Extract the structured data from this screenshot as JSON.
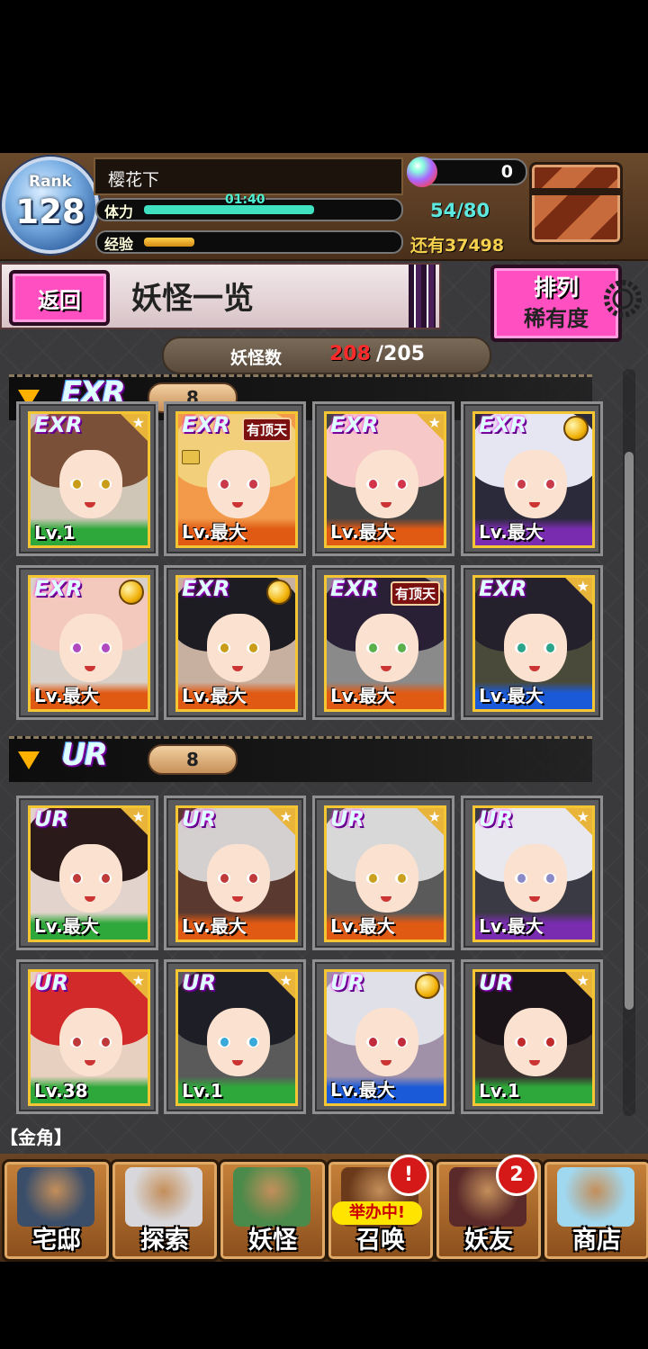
{
  "colors": {
    "accent_pink": "#ff4fc1",
    "gold": "#f6d14d",
    "stamina": "#5de8e0",
    "count_red": "#ff2a2a"
  },
  "header": {
    "rank_label": "Rank",
    "rank_value": "128",
    "player_name": "樱花下",
    "stamina_label": "体力",
    "stamina_timer": "01:40",
    "stamina_value": "54/80",
    "stamina_fraction": 0.675,
    "exp_label": "经验",
    "exp_fraction": 0.2,
    "gem_count": "0",
    "gold_text": "还有37498"
  },
  "title_bar": {
    "back_label": "返回",
    "page_title": "妖怪一览",
    "sort_label": "排列",
    "sort_value": "稀有度"
  },
  "monster_count": {
    "label": "妖怪数",
    "owned": "208",
    "capacity": "/205"
  },
  "sections": [
    {
      "rarity": "EXR",
      "count": "8",
      "cards": [
        {
          "rarity": "EXR",
          "level": "Lv.1",
          "strip": "#2ea83a",
          "hair": "#7a5138",
          "eye": "#c99c1a",
          "bg": "#cfc6b8",
          "mark": "star",
          "lock": false
        },
        {
          "rarity": "EXR",
          "level": "Lv.最大",
          "strip": "#e05a14",
          "hair": "#f2cf7a",
          "eye": "#c93a4a",
          "bg": "#f29a4a",
          "mark": "tag",
          "tag": "有顶天",
          "lock": true
        },
        {
          "rarity": "EXR",
          "level": "Lv.最大",
          "strip": "#e05a14",
          "hair": "#f7c8c8",
          "eye": "#d2344a",
          "bg": "#444",
          "mark": "star",
          "lock": false
        },
        {
          "rarity": "EXR",
          "level": "Lv.最大",
          "strip": "#7a2cb0",
          "hair": "#e6e6f2",
          "eye": "#c93a4a",
          "bg": "#2a2a3a",
          "mark": "medal",
          "lock": false
        },
        {
          "rarity": "EXR",
          "level": "Lv.最大",
          "strip": "#e05a14",
          "hair": "#f3c9bd",
          "eye": "#b048c0",
          "bg": "#d8d0c8",
          "mark": "medal",
          "lock": false
        },
        {
          "rarity": "EXR",
          "level": "Lv.最大",
          "strip": "#e05a14",
          "hair": "#1c1c22",
          "eye": "#c99c1a",
          "bg": "#c8b0a0",
          "mark": "medal",
          "lock": false
        },
        {
          "rarity": "EXR",
          "level": "Lv.最大",
          "strip": "#e05a14",
          "hair": "#2a2036",
          "eye": "#5ab04a",
          "bg": "#8a8a8a",
          "mark": "tag",
          "tag": "有顶天",
          "lock": false
        },
        {
          "rarity": "EXR",
          "level": "Lv.最大",
          "strip": "#1a5ad8",
          "hair": "#24202c",
          "eye": "#2aa58a",
          "bg": "#4a4a3a",
          "mark": "star",
          "lock": false
        }
      ]
    },
    {
      "rarity": "UR",
      "count": "8",
      "cards": [
        {
          "rarity": "UR",
          "level": "Lv.最大",
          "strip": "#2ea83a",
          "hair": "#2a1a1a",
          "eye": "#c03a3a",
          "bg": "#e2d4cc",
          "mark": "star",
          "lock": false
        },
        {
          "rarity": "UR",
          "level": "Lv.最大",
          "strip": "#e05a14",
          "hair": "#d4d0d0",
          "eye": "#c03a3a",
          "bg": "#5a3a30",
          "mark": "star",
          "lock": false
        },
        {
          "rarity": "UR",
          "level": "Lv.最大",
          "strip": "#e05a14",
          "hair": "#d8d8d8",
          "eye": "#c9a020",
          "bg": "#5a5a5a",
          "mark": "star",
          "lock": false
        },
        {
          "rarity": "UR",
          "level": "Lv.最大",
          "strip": "#7a2cb0",
          "hair": "#e8e8ee",
          "eye": "#8a8ac8",
          "bg": "#3a3a44",
          "mark": "star",
          "lock": false
        },
        {
          "rarity": "UR",
          "level": "Lv.38",
          "strip": "#2ea83a",
          "hair": "#d22a2a",
          "eye": "#c03a3a",
          "bg": "#e8d0c0",
          "mark": "star",
          "lock": false
        },
        {
          "rarity": "UR",
          "level": "Lv.1",
          "strip": "#2ea83a",
          "hair": "#1e1e26",
          "eye": "#3aa8d8",
          "bg": "#5a5a5a",
          "mark": "star",
          "lock": false
        },
        {
          "rarity": "UR",
          "level": "Lv.最大",
          "strip": "#1a5ad8",
          "hair": "#e0e0e8",
          "eye": "#c02a3a",
          "bg": "#a090a8",
          "mark": "medal",
          "lock": false
        },
        {
          "rarity": "UR",
          "level": "Lv.1",
          "strip": "#2ea83a",
          "hair": "#1a1418",
          "eye": "#c02a2a",
          "bg": "#3a3030",
          "mark": "star",
          "lock": false
        }
      ]
    }
  ],
  "helper_text": "【金角】",
  "nav": [
    {
      "label": "宅邸",
      "icon": "house-icon",
      "pic": "#3a4e6a"
    },
    {
      "label": "探索",
      "icon": "magnifier-map-icon",
      "pic": "#d8d8dc"
    },
    {
      "label": "妖怪",
      "icon": "scroll-icon",
      "pic": "#4a8a4a"
    },
    {
      "label": "召唤",
      "icon": "summon-star-icon",
      "pic": "#6a3a1a",
      "badge": "!",
      "pill": "举办中!"
    },
    {
      "label": "妖友",
      "icon": "friend-portrait-icon",
      "pic": "#5a2a2a",
      "badge": "2"
    },
    {
      "label": "商店",
      "icon": "crystal-orb-icon",
      "pic": "#a0d8f0"
    }
  ]
}
